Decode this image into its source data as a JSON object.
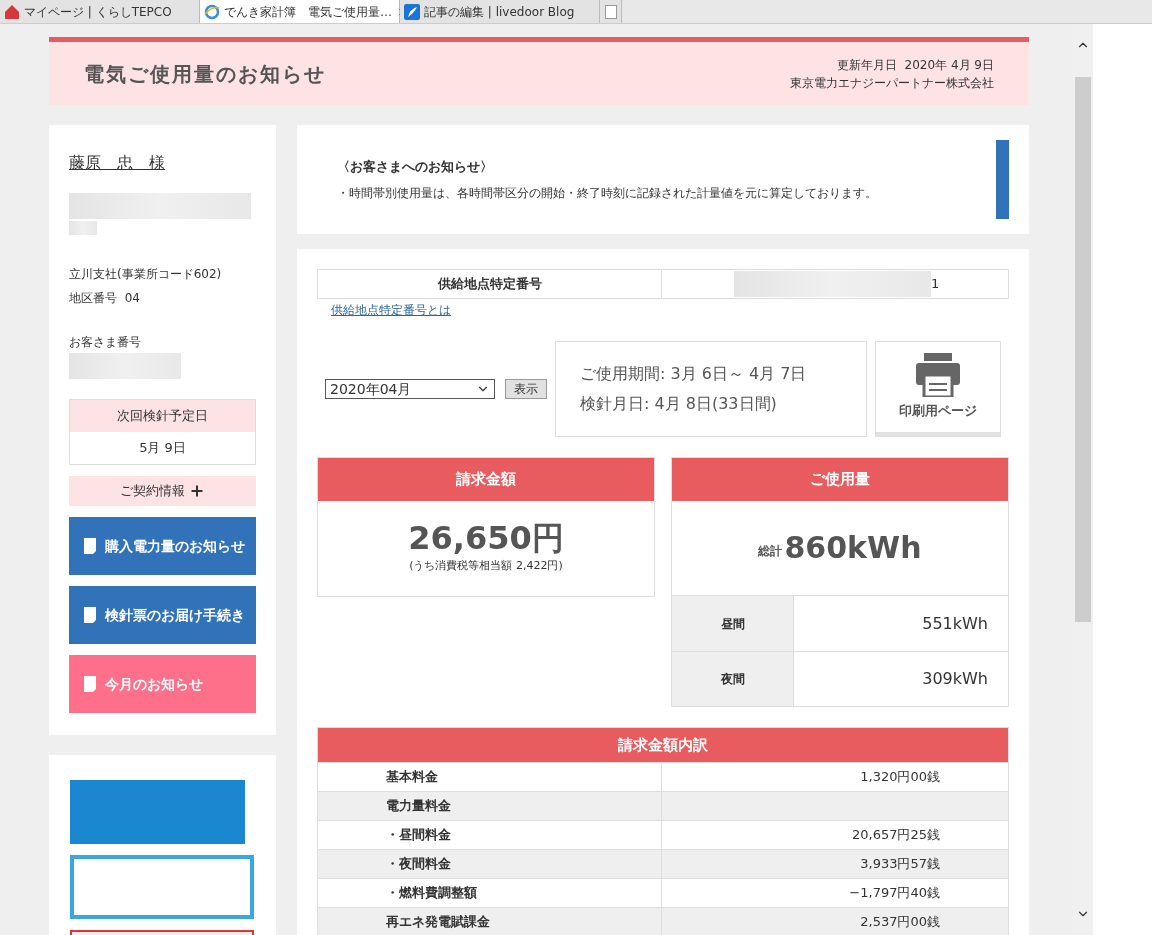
{
  "browser": {
    "tabs": [
      {
        "kind": "home",
        "label": "マイページ | くらしTEPCO",
        "selected": false
      },
      {
        "kind": "globe",
        "label": "でんき家計簿　電気ご使用量…",
        "selected": true
      },
      {
        "kind": "feather",
        "label": "記事の編集 | livedoor Blog",
        "selected": false
      }
    ]
  },
  "page_header": {
    "title": "電気ご使用量のお知らせ",
    "updated_label": "更新年月日",
    "updated_date": "2020年 4月 9日",
    "company": "東京電力エナジーパートナー株式会社"
  },
  "customer": {
    "name": "藤原　忠　様",
    "branch": "立川支社(事業所コード602)",
    "district_label": "地区番号",
    "district": "04",
    "number_label": "お客さま番号"
  },
  "next_reading": {
    "label": "次回検針予定日",
    "date": "5月 9日"
  },
  "contract_info": {
    "label": "ご契約情報",
    "expanded": false
  },
  "nav_buttons": [
    {
      "label": "購入電力量のお知らせ",
      "color": "#3272b9"
    },
    {
      "label": "検針票のお届け手続き",
      "color": "#3272b9"
    },
    {
      "label": "今月のお知らせ",
      "color": "#fe6f8a"
    }
  ],
  "notice": {
    "title": "〈お客さまへのお知らせ〉",
    "text": "・時間帯別使用量は、各時間帯区分の開始・終了時刻に記録された計量値を元に算定しております。"
  },
  "supply_point": {
    "label": "供給地点特定番号",
    "value": "1",
    "link": "供給地点特定番号とは"
  },
  "period_select": {
    "value": "2020年04月",
    "button": "表示"
  },
  "period": {
    "usage_period": "ご使用期間: 3月 6日～ 4月 7日",
    "reading_date": "検針月日: 4月 8日(33日間)"
  },
  "print_button": "印刷用ページ",
  "billing": {
    "title": "請求金額",
    "amount": "26,650円",
    "tax_note": "(うち消費税等相当額 2,422円)"
  },
  "usage": {
    "title": "ご使用量",
    "total_label": "総計",
    "total": "860kWh",
    "rows": [
      {
        "label": "昼間",
        "value": "551kWh"
      },
      {
        "label": "夜間",
        "value": "309kWh"
      }
    ]
  },
  "breakdown": {
    "title": "請求金額内訳",
    "rows": [
      {
        "label": "基本料金",
        "value": "1,320円00銭"
      },
      {
        "label": "電力量料金"
      },
      {
        "label": "・昼間料金",
        "value": "20,657円25銭"
      },
      {
        "label": "・夜間料金",
        "value": "3,933円57銭"
      },
      {
        "label": "・燃料費調整額",
        "value": "−1,797円40銭"
      },
      {
        "label": "再エネ発電賦課金",
        "value": "2,537円00銭"
      }
    ]
  }
}
